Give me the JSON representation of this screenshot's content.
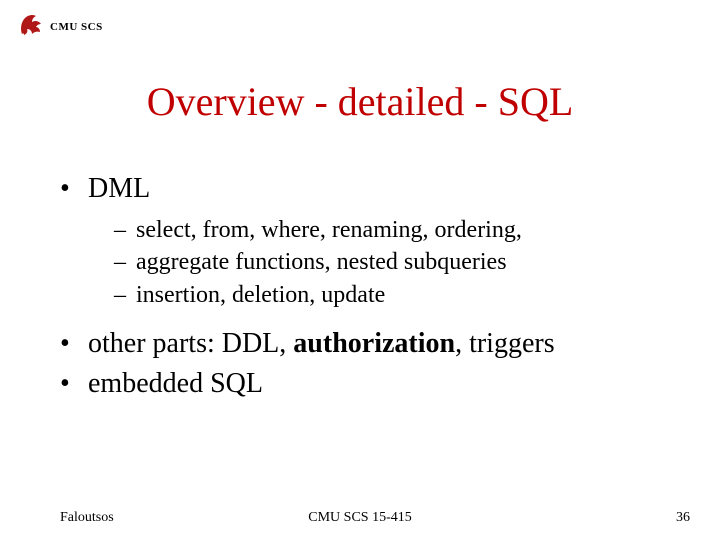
{
  "header": {
    "org_label": "CMU SCS",
    "logo_name": "cmu-scotty-logo"
  },
  "title": "Overview - detailed - SQL",
  "bullets": {
    "b1": "DML",
    "b1_sub1": "select, from, where, renaming, ordering,",
    "b1_sub2_lead": " ",
    "b1_sub2": "aggregate functions, nested subqueries",
    "b1_sub3": "insertion, deletion, update",
    "b2_pre": "other parts: DDL, ",
    "b2_bold": "authorization",
    "b2_post": ", triggers",
    "b3": "embedded SQL"
  },
  "footer": {
    "author": "Faloutsos",
    "course": "CMU SCS 15-415",
    "page": "36"
  }
}
